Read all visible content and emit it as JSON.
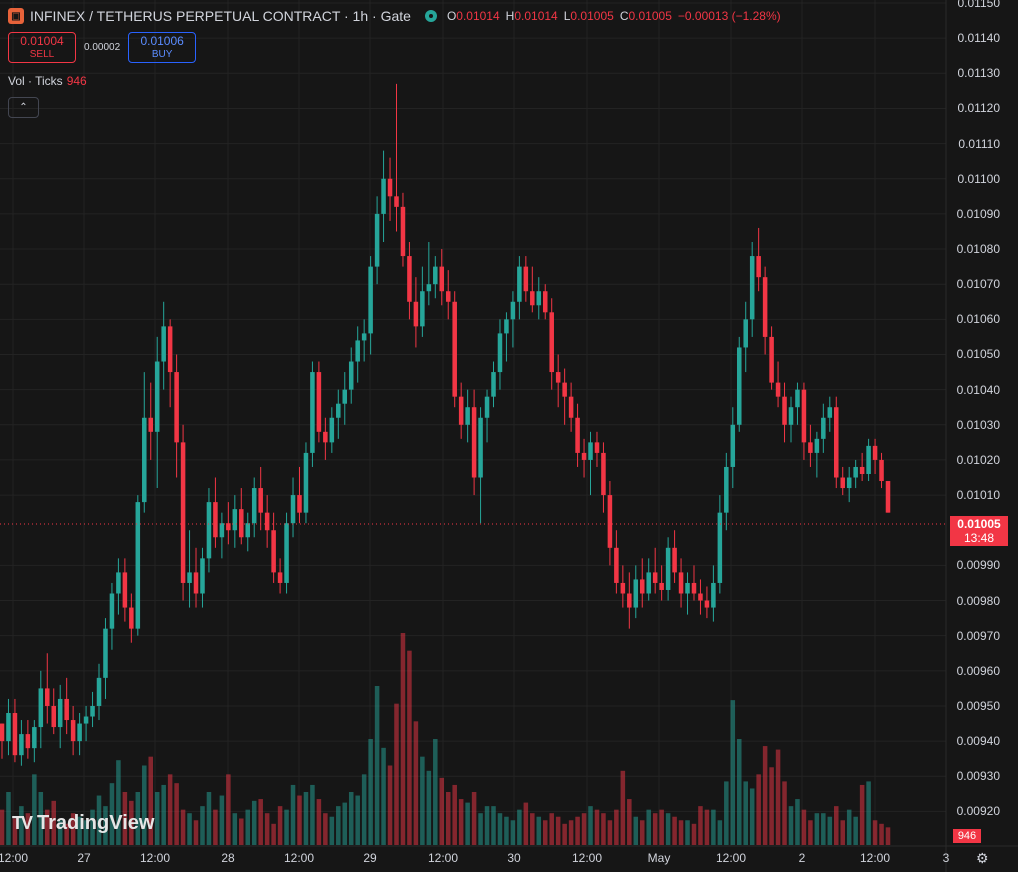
{
  "header": {
    "logo_icon": "exchange-logo-icon",
    "title": "INFINEX / TETHERUS PERPETUAL CONTRACT · 1h · Gate",
    "status_icon": "market-open-icon",
    "ohlc": {
      "o_label": "O",
      "o_value": "0.01014",
      "h_label": "H",
      "h_value": "0.01014",
      "l_label": "L",
      "l_value": "0.01005",
      "c_label": "C",
      "c_value": "0.01005",
      "change": "−0.00013 (−1.28%)"
    }
  },
  "trade": {
    "sell_price": "0.01004",
    "sell_label": "SELL",
    "spread": "0.00002",
    "buy_price": "0.01006",
    "buy_label": "BUY"
  },
  "volume_legend": {
    "label": "Vol · Ticks",
    "value": "946"
  },
  "collapse_icon": "chevron-up-icon",
  "watermark": {
    "text": "TradingView",
    "icon": "tradingview-logo-icon"
  },
  "price_axis": {
    "labels": [
      "0.01150",
      "0.01140",
      "0.01130",
      "0.01120",
      "0.01110",
      "0.01100",
      "0.01090",
      "0.01080",
      "0.01070",
      "0.01060",
      "0.01050",
      "0.01040",
      "0.01030",
      "0.01020",
      "0.01010",
      "0.00990",
      "0.00980",
      "0.00970",
      "0.00960",
      "0.00950",
      "0.00940",
      "0.00930",
      "0.00920"
    ],
    "last_price": "0.01005",
    "countdown": "13:48",
    "volume_last": "946"
  },
  "time_axis": {
    "labels": [
      "12:00",
      "27",
      "12:00",
      "28",
      "12:00",
      "29",
      "12:00",
      "30",
      "12:00",
      "May",
      "12:00",
      "2",
      "12:00",
      "3"
    ]
  },
  "settings_icon": "settings-gear-icon",
  "colors": {
    "up": "#26a69a",
    "down": "#f23645",
    "background": "#161616",
    "grid": "#232323"
  },
  "chart_data": {
    "type": "candlestick",
    "series_name": "INFINEX / TETHERUS PERPETUAL CONTRACT",
    "interval": "1h",
    "ylim": [
      0.00915,
      0.0115
    ],
    "candles": [
      [
        0.00945,
        0.00945,
        0.00935,
        0.0094
      ],
      [
        0.0094,
        0.00952,
        0.00936,
        0.00948
      ],
      [
        0.00948,
        0.00952,
        0.00934,
        0.00936
      ],
      [
        0.00936,
        0.00946,
        0.00933,
        0.00942
      ],
      [
        0.00942,
        0.00946,
        0.00935,
        0.00938
      ],
      [
        0.00938,
        0.00946,
        0.00934,
        0.00944
      ],
      [
        0.00944,
        0.0096,
        0.00938,
        0.00955
      ],
      [
        0.00955,
        0.00965,
        0.00945,
        0.0095
      ],
      [
        0.0095,
        0.00955,
        0.00942,
        0.00944
      ],
      [
        0.00944,
        0.00956,
        0.00938,
        0.00952
      ],
      [
        0.00952,
        0.00958,
        0.00942,
        0.00946
      ],
      [
        0.00946,
        0.0095,
        0.00936,
        0.0094
      ],
      [
        0.0094,
        0.00948,
        0.00936,
        0.00945
      ],
      [
        0.00945,
        0.0095,
        0.0094,
        0.00947
      ],
      [
        0.00947,
        0.00954,
        0.00944,
        0.0095
      ],
      [
        0.0095,
        0.00962,
        0.00946,
        0.00958
      ],
      [
        0.00958,
        0.00975,
        0.00952,
        0.00972
      ],
      [
        0.00972,
        0.00985,
        0.00966,
        0.00982
      ],
      [
        0.00982,
        0.00992,
        0.00976,
        0.00988
      ],
      [
        0.00988,
        0.00992,
        0.00974,
        0.00978
      ],
      [
        0.00978,
        0.00982,
        0.00968,
        0.00972
      ],
      [
        0.00972,
        0.0101,
        0.0097,
        0.01008
      ],
      [
        0.01008,
        0.01045,
        0.01005,
        0.01032
      ],
      [
        0.01032,
        0.01042,
        0.0102,
        0.01028
      ],
      [
        0.01028,
        0.01055,
        0.01012,
        0.01048
      ],
      [
        0.01048,
        0.01065,
        0.0104,
        0.01058
      ],
      [
        0.01058,
        0.0106,
        0.01035,
        0.01045
      ],
      [
        0.01045,
        0.0105,
        0.01015,
        0.01025
      ],
      [
        0.01025,
        0.0103,
        0.0098,
        0.00985
      ],
      [
        0.00985,
        0.01,
        0.00978,
        0.00988
      ],
      [
        0.00988,
        0.00995,
        0.00978,
        0.00982
      ],
      [
        0.00982,
        0.00995,
        0.00978,
        0.00992
      ],
      [
        0.00992,
        0.01012,
        0.00988,
        0.01008
      ],
      [
        0.01008,
        0.01015,
        0.00995,
        0.00998
      ],
      [
        0.00998,
        0.01005,
        0.00992,
        0.01002
      ],
      [
        0.01002,
        0.01008,
        0.00996,
        0.01
      ],
      [
        0.01,
        0.0101,
        0.00995,
        0.01006
      ],
      [
        0.01006,
        0.01012,
        0.00996,
        0.00998
      ],
      [
        0.00998,
        0.01005,
        0.00994,
        0.01002
      ],
      [
        0.01002,
        0.01015,
        0.00998,
        0.01012
      ],
      [
        0.01012,
        0.01018,
        0.01,
        0.01005
      ],
      [
        0.01005,
        0.0101,
        0.00995,
        0.01
      ],
      [
        0.01,
        0.01005,
        0.00985,
        0.00988
      ],
      [
        0.00988,
        0.00992,
        0.00982,
        0.00985
      ],
      [
        0.00985,
        0.01005,
        0.00982,
        0.01002
      ],
      [
        0.01002,
        0.01015,
        0.00998,
        0.0101
      ],
      [
        0.0101,
        0.01018,
        0.01002,
        0.01005
      ],
      [
        0.01005,
        0.01025,
        0.01002,
        0.01022
      ],
      [
        0.01022,
        0.01048,
        0.01018,
        0.01045
      ],
      [
        0.01045,
        0.01048,
        0.01025,
        0.01028
      ],
      [
        0.01028,
        0.01032,
        0.0102,
        0.01025
      ],
      [
        0.01025,
        0.01035,
        0.01022,
        0.01032
      ],
      [
        0.01032,
        0.0104,
        0.01026,
        0.01036
      ],
      [
        0.01036,
        0.01045,
        0.0103,
        0.0104
      ],
      [
        0.0104,
        0.01052,
        0.01036,
        0.01048
      ],
      [
        0.01048,
        0.01058,
        0.01042,
        0.01054
      ],
      [
        0.01054,
        0.0106,
        0.01048,
        0.01056
      ],
      [
        0.01056,
        0.01078,
        0.0105,
        0.01075
      ],
      [
        0.01075,
        0.01095,
        0.0107,
        0.0109
      ],
      [
        0.0109,
        0.01108,
        0.01082,
        0.011
      ],
      [
        0.011,
        0.01106,
        0.01088,
        0.01095
      ],
      [
        0.01095,
        0.01127,
        0.01085,
        0.01092
      ],
      [
        0.01092,
        0.01096,
        0.01075,
        0.01078
      ],
      [
        0.01078,
        0.01082,
        0.0106,
        0.01065
      ],
      [
        0.01065,
        0.01072,
        0.01052,
        0.01058
      ],
      [
        0.01058,
        0.01075,
        0.01055,
        0.01068
      ],
      [
        0.01068,
        0.01082,
        0.01064,
        0.0107
      ],
      [
        0.0107,
        0.01078,
        0.01066,
        0.01075
      ],
      [
        0.01075,
        0.0108,
        0.01064,
        0.01068
      ],
      [
        0.01068,
        0.01074,
        0.0106,
        0.01065
      ],
      [
        0.01065,
        0.01068,
        0.01035,
        0.01038
      ],
      [
        0.01038,
        0.01042,
        0.01026,
        0.0103
      ],
      [
        0.0103,
        0.0104,
        0.01025,
        0.01035
      ],
      [
        0.01035,
        0.0104,
        0.0101,
        0.01015
      ],
      [
        0.01015,
        0.01035,
        0.01002,
        0.01032
      ],
      [
        0.01032,
        0.0104,
        0.01025,
        0.01038
      ],
      [
        0.01038,
        0.01048,
        0.01035,
        0.01045
      ],
      [
        0.01045,
        0.0106,
        0.0104,
        0.01056
      ],
      [
        0.01056,
        0.01062,
        0.01048,
        0.0106
      ],
      [
        0.0106,
        0.01068,
        0.01052,
        0.01065
      ],
      [
        0.01065,
        0.01078,
        0.0106,
        0.01075
      ],
      [
        0.01075,
        0.01078,
        0.01065,
        0.01068
      ],
      [
        0.01068,
        0.01075,
        0.01062,
        0.01064
      ],
      [
        0.01064,
        0.01072,
        0.0106,
        0.01068
      ],
      [
        0.01068,
        0.0107,
        0.0106,
        0.01062
      ],
      [
        0.01062,
        0.01066,
        0.0104,
        0.01045
      ],
      [
        0.01045,
        0.0105,
        0.01035,
        0.01042
      ],
      [
        0.01042,
        0.01046,
        0.0103,
        0.01038
      ],
      [
        0.01038,
        0.01042,
        0.01028,
        0.01032
      ],
      [
        0.01032,
        0.01036,
        0.01018,
        0.01022
      ],
      [
        0.01022,
        0.01026,
        0.01015,
        0.0102
      ],
      [
        0.0102,
        0.01028,
        0.0101,
        0.01025
      ],
      [
        0.01025,
        0.01028,
        0.01018,
        0.01022
      ],
      [
        0.01022,
        0.01025,
        0.01005,
        0.0101
      ],
      [
        0.0101,
        0.01014,
        0.0099,
        0.00995
      ],
      [
        0.00995,
        0.01,
        0.00982,
        0.00985
      ],
      [
        0.00985,
        0.0099,
        0.00978,
        0.00982
      ],
      [
        0.00982,
        0.00988,
        0.00972,
        0.00978
      ],
      [
        0.00978,
        0.0099,
        0.00975,
        0.00986
      ],
      [
        0.00986,
        0.00992,
        0.00978,
        0.00982
      ],
      [
        0.00982,
        0.00992,
        0.0098,
        0.00988
      ],
      [
        0.00988,
        0.00995,
        0.00982,
        0.00985
      ],
      [
        0.00985,
        0.0099,
        0.0098,
        0.00983
      ],
      [
        0.00983,
        0.00998,
        0.0098,
        0.00995
      ],
      [
        0.00995,
        0.01,
        0.00985,
        0.00988
      ],
      [
        0.00988,
        0.00992,
        0.00978,
        0.00982
      ],
      [
        0.00982,
        0.00988,
        0.00976,
        0.00985
      ],
      [
        0.00985,
        0.0099,
        0.0098,
        0.00982
      ],
      [
        0.00982,
        0.00986,
        0.00976,
        0.0098
      ],
      [
        0.0098,
        0.00984,
        0.00975,
        0.00978
      ],
      [
        0.00978,
        0.0099,
        0.00974,
        0.00985
      ],
      [
        0.00985,
        0.0101,
        0.00982,
        0.01005
      ],
      [
        0.01005,
        0.01022,
        0.01,
        0.01018
      ],
      [
        0.01018,
        0.01035,
        0.01012,
        0.0103
      ],
      [
        0.0103,
        0.01055,
        0.01028,
        0.01052
      ],
      [
        0.01052,
        0.01065,
        0.01045,
        0.0106
      ],
      [
        0.0106,
        0.01082,
        0.01055,
        0.01078
      ],
      [
        0.01078,
        0.01086,
        0.01068,
        0.01072
      ],
      [
        0.01072,
        0.01075,
        0.0105,
        0.01055
      ],
      [
        0.01055,
        0.01058,
        0.0104,
        0.01042
      ],
      [
        0.01042,
        0.01048,
        0.01035,
        0.01038
      ],
      [
        0.01038,
        0.01042,
        0.01025,
        0.0103
      ],
      [
        0.0103,
        0.01038,
        0.01025,
        0.01035
      ],
      [
        0.01035,
        0.01042,
        0.0103,
        0.0104
      ],
      [
        0.0104,
        0.01042,
        0.0102,
        0.01025
      ],
      [
        0.01025,
        0.0103,
        0.01018,
        0.01022
      ],
      [
        0.01022,
        0.01028,
        0.01015,
        0.01026
      ],
      [
        0.01026,
        0.01036,
        0.01022,
        0.01032
      ],
      [
        0.01032,
        0.01038,
        0.01028,
        0.01035
      ],
      [
        0.01035,
        0.01038,
        0.01012,
        0.01015
      ],
      [
        0.01015,
        0.01018,
        0.0101,
        0.01012
      ],
      [
        0.01012,
        0.01018,
        0.01008,
        0.01015
      ],
      [
        0.01015,
        0.0102,
        0.01012,
        0.01018
      ],
      [
        0.01018,
        0.01022,
        0.01014,
        0.01016
      ],
      [
        0.01016,
        0.01026,
        0.01014,
        0.01024
      ],
      [
        0.01024,
        0.01026,
        0.01016,
        0.0102
      ],
      [
        0.0102,
        0.01022,
        0.01012,
        0.01014
      ],
      [
        0.01014,
        0.01014,
        0.01005,
        0.01005
      ]
    ],
    "volume": [
      20,
      30,
      15,
      22,
      18,
      40,
      30,
      20,
      25,
      14,
      12,
      18,
      16,
      14,
      20,
      28,
      22,
      35,
      48,
      30,
      25,
      30,
      45,
      50,
      30,
      34,
      40,
      35,
      20,
      18,
      14,
      22,
      30,
      20,
      28,
      40,
      18,
      15,
      20,
      25,
      26,
      18,
      12,
      22,
      20,
      34,
      28,
      30,
      34,
      26,
      18,
      16,
      22,
      24,
      30,
      28,
      40,
      60,
      90,
      55,
      45,
      80,
      120,
      110,
      70,
      50,
      42,
      60,
      38,
      30,
      34,
      26,
      24,
      30,
      18,
      22,
      22,
      18,
      16,
      14,
      20,
      24,
      18,
      16,
      14,
      18,
      16,
      12,
      14,
      16,
      18,
      22,
      20,
      18,
      14,
      20,
      42,
      26,
      16,
      14,
      20,
      18,
      20,
      18,
      16,
      14,
      14,
      12,
      22,
      20,
      20,
      14,
      36,
      82,
      60,
      36,
      32,
      40,
      56,
      44,
      54,
      36,
      22,
      26,
      20,
      14,
      18,
      18,
      16,
      22,
      14,
      20,
      16,
      34,
      36,
      14,
      12,
      10,
      8,
      8,
      6,
      5
    ]
  }
}
